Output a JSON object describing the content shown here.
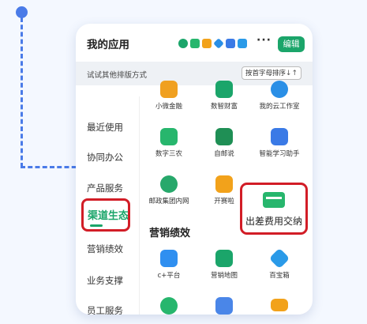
{
  "header": {
    "title": "我的应用",
    "edit_label": "编辑",
    "more_label": "···"
  },
  "subbar": {
    "hint": "试试其他排版方式",
    "sort_label": "按首字母排序",
    "sort_icon": "↓↑"
  },
  "sidebar": {
    "items": [
      {
        "label": "最近使用",
        "active": false
      },
      {
        "label": "协同办公",
        "active": false
      },
      {
        "label": "产品服务",
        "active": false
      },
      {
        "label": "渠道生态",
        "active": true
      },
      {
        "label": "营销绩效",
        "active": false
      },
      {
        "label": "业务支撑",
        "active": false
      },
      {
        "label": "员工服务",
        "active": false
      }
    ]
  },
  "apps_top": [
    {
      "label": "小微金融",
      "icon": "money-bag-icon",
      "color": "#f0a020"
    },
    {
      "label": "数智财富",
      "icon": "coins-icon",
      "color": "#1ba56a"
    },
    {
      "label": "我的云工作室",
      "icon": "cloud-icon",
      "color": "#2a8fe6"
    },
    {
      "label": "数字三农",
      "icon": "jar-icon",
      "color": "#27b66d"
    },
    {
      "label": "自邮说",
      "icon": "newspaper-icon",
      "color": "#1f8f55"
    },
    {
      "label": "智能学习助手",
      "icon": "robot-icon",
      "color": "#3a7ae6"
    },
    {
      "label": "邮政集团内网",
      "icon": "globe-icon",
      "color": "#27a86b"
    },
    {
      "label": "开赛啦",
      "icon": "trophy-icon",
      "color": "#f2a21b"
    }
  ],
  "highlight_app": {
    "label": "出差费用交纳",
    "icon": "card-icon",
    "color": "#27b66d"
  },
  "section": {
    "title": "营销绩效"
  },
  "apps_bottom": [
    {
      "label": "c+平台",
      "icon": "crm-icon",
      "color": "#2f8ff0"
    },
    {
      "label": "营销地图",
      "icon": "map-icon",
      "color": "#1ba56a"
    },
    {
      "label": "百宝箱",
      "icon": "cube-icon",
      "color": "#2a9ae8"
    }
  ],
  "apps_partial": [
    {
      "label": "",
      "icon": "chat-icon",
      "color": "#27b66d"
    },
    {
      "label": "",
      "icon": "document-icon",
      "color": "#4a86e8"
    },
    {
      "label": "",
      "icon": "card-icon",
      "color": "#f2a21b"
    }
  ],
  "colors": {
    "accent": "#1ba56a",
    "highlight": "#d21d27",
    "guide": "#4a7be8"
  }
}
